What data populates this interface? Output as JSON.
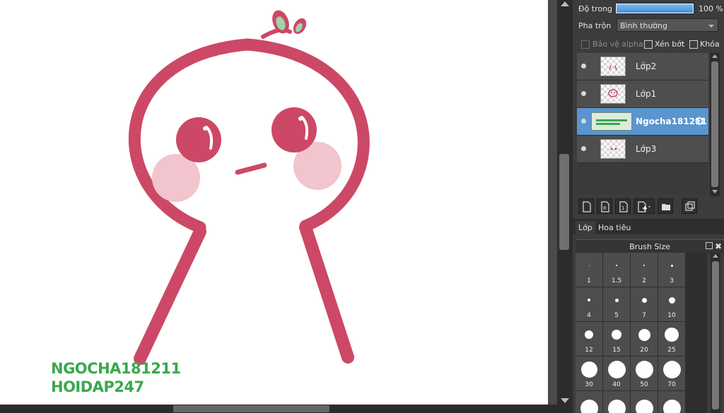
{
  "canvas": {
    "watermark_line1": "NGOCHA181211",
    "watermark_line2": "HOIDAP247",
    "character_color": "#cc4866",
    "cheek_color": "#f2c4cd",
    "leaf_color": "#9fd4a6"
  },
  "layer_panel": {
    "opacity_label": "Độ trong",
    "opacity_value": "100 %",
    "opacity_fraction": 1.0,
    "blend_label": "Pha trộn",
    "blend_value": "Bình thường",
    "protect_alpha_label": "Bảo vệ alpha",
    "clipping_label": "Xén bớt",
    "lock_label": "Khóa",
    "layers": [
      {
        "name": "Lớp2",
        "selected": false
      },
      {
        "name": "Lớp1",
        "selected": false
      },
      {
        "name": "Ngocha181211",
        "selected": true
      },
      {
        "name": "Lớp3",
        "selected": false
      }
    ],
    "accent": "#5a95cf"
  },
  "tabs": [
    {
      "label": "Lớp",
      "active": true
    },
    {
      "label": "Hoa tiêu",
      "active": false
    }
  ],
  "brush_panel": {
    "title": "Brush Size",
    "sizes": [
      "1",
      "1.5",
      "2",
      "3",
      "4",
      "5",
      "7",
      "10",
      "12",
      "15",
      "20",
      "25",
      "30",
      "40",
      "50",
      "70",
      "",
      "",
      "",
      ""
    ]
  },
  "icons": [
    "new-layer-icon",
    "new-layer-icon-2",
    "new-layer-icon-3",
    "add-layer-icon",
    "folder-icon",
    "duplicate-icon",
    "gear-icon",
    "popout-icon",
    "close-icon"
  ]
}
